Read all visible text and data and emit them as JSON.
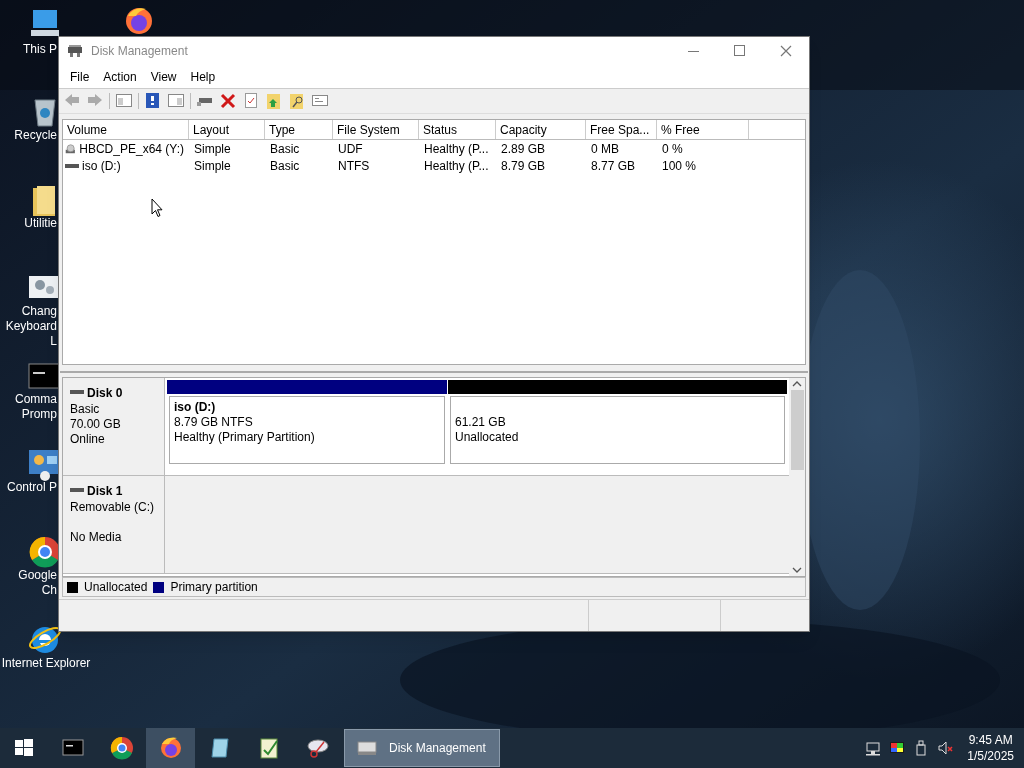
{
  "desktop_icons": [
    {
      "kind": "pc",
      "label": "This P"
    },
    {
      "kind": "recycle",
      "label": "Recycle"
    },
    {
      "kind": "folder",
      "label": "Utilitie"
    },
    {
      "kind": "gears",
      "label": "Chang Keyboard L"
    },
    {
      "kind": "cmd",
      "label": "Comma Promp"
    },
    {
      "kind": "control",
      "label": "Control P"
    },
    {
      "kind": "chrome",
      "label": "Google Ch"
    },
    {
      "kind": "ie",
      "label": "Internet Explorer"
    }
  ],
  "window": {
    "title": "Disk Management",
    "menu": [
      "File",
      "Action",
      "View",
      "Help"
    ],
    "volumes": {
      "columns": [
        "Volume",
        "Layout",
        "Type",
        "File System",
        "Status",
        "Capacity",
        "Free Spa...",
        "% Free"
      ],
      "rows": [
        {
          "kind": "optical",
          "cells": [
            "HBCD_PE_x64 (Y:)",
            "Simple",
            "Basic",
            "UDF",
            "Healthy (P...",
            "2.89 GB",
            "0 MB",
            "0 %"
          ]
        },
        {
          "kind": "disk",
          "cells": [
            "iso (D:)",
            "Simple",
            "Basic",
            "NTFS",
            "Healthy (P...",
            "8.79 GB",
            "8.77 GB",
            "100 %"
          ]
        }
      ]
    },
    "disks": [
      {
        "name": "Disk 0",
        "type": "Basic",
        "size": "70.00 GB",
        "status": "Online",
        "partitions": [
          {
            "name": "iso  (D:)",
            "lines": [
              "8.79 GB NTFS",
              "Healthy (Primary Partition)"
            ],
            "color": "#000080"
          },
          {
            "lines": [
              "61.21 GB",
              "Unallocated"
            ],
            "color": "#000000"
          }
        ]
      },
      {
        "name": "Disk 1",
        "type": "Removable (C:)",
        "status": "No Media"
      }
    ],
    "legend": [
      {
        "label": "Unallocated",
        "color": "#000000"
      },
      {
        "label": "Primary partition",
        "color": "#000080"
      }
    ]
  },
  "taskbar": {
    "apps": [
      {
        "kind": "cmd",
        "selected": false
      },
      {
        "kind": "chrome",
        "selected": false
      },
      {
        "kind": "firefox",
        "selected": true
      },
      {
        "kind": "notepad",
        "selected": false
      },
      {
        "kind": "editor",
        "selected": false
      },
      {
        "kind": "tool",
        "selected": false
      },
      {
        "kind": "disk",
        "label": "Disk Management",
        "selected": true
      }
    ],
    "clock": {
      "time": "9:45 AM",
      "date": "1/5/2025"
    }
  }
}
